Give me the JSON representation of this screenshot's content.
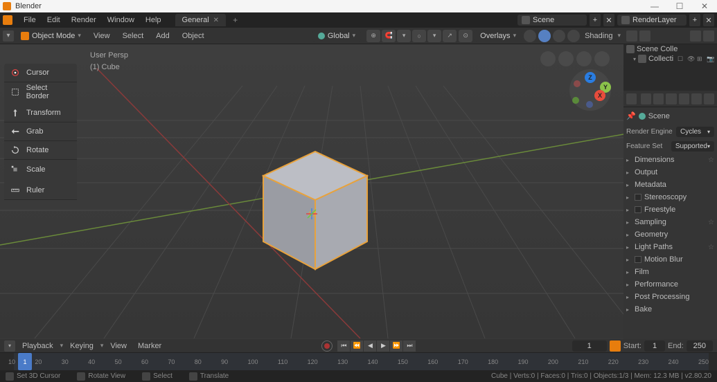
{
  "app": {
    "title": "Blender"
  },
  "menubar": {
    "items": [
      "File",
      "Edit",
      "Render",
      "Window",
      "Help"
    ],
    "workspace": "General",
    "scene": "Scene",
    "render_layer": "RenderLayer"
  },
  "viewport": {
    "mode": "Object Mode",
    "menus": [
      "View",
      "Select",
      "Add",
      "Object"
    ],
    "orientation": "Global",
    "overlays": "Overlays",
    "shading": "Shading",
    "info_line1": "User Persp",
    "info_line2": "(1) Cube"
  },
  "tools": [
    "Cursor",
    "Select Border",
    "Transform",
    "Grab",
    "Rotate",
    "Scale",
    "Ruler"
  ],
  "outliner": {
    "scene_collection": "Scene Colle",
    "collection": "Collecti"
  },
  "properties": {
    "breadcrumb": "Scene",
    "render_engine_label": "Render Engine",
    "render_engine_value": "Cycles",
    "feature_set_label": "Feature Set",
    "feature_set_value": "Supported",
    "panels": [
      {
        "name": "Dimensions",
        "star": true
      },
      {
        "name": "Output"
      },
      {
        "name": "Metadata"
      },
      {
        "name": "Stereoscopy",
        "checkbox": true
      },
      {
        "name": "Freestyle",
        "checkbox": true
      },
      {
        "name": "Sampling",
        "star": true
      },
      {
        "name": "Geometry"
      },
      {
        "name": "Light Paths",
        "star": true
      },
      {
        "name": "Motion Blur",
        "checkbox": true
      },
      {
        "name": "Film"
      },
      {
        "name": "Performance"
      },
      {
        "name": "Post Processing"
      },
      {
        "name": "Bake"
      }
    ]
  },
  "timeline": {
    "menus": [
      "Playback",
      "Keying",
      "View",
      "Marker"
    ],
    "current_frame": "1",
    "start_label": "Start:",
    "start_value": "1",
    "end_label": "End:",
    "end_value": "250",
    "marks": [
      "10",
      "20",
      "30",
      "40",
      "50",
      "60",
      "70",
      "80",
      "90",
      "100",
      "110",
      "120",
      "130",
      "140",
      "150",
      "160",
      "170",
      "180",
      "190",
      "200",
      "210",
      "220",
      "230",
      "240",
      "250"
    ]
  },
  "statusbar": {
    "actions": [
      "Set 3D Cursor",
      "Rotate View",
      "Select",
      "Translate"
    ],
    "stats": "Cube | Verts:0 | Faces:0 | Tris:0 | Objects:1/3 | Mem: 12.3 MB | v2.80.20"
  }
}
